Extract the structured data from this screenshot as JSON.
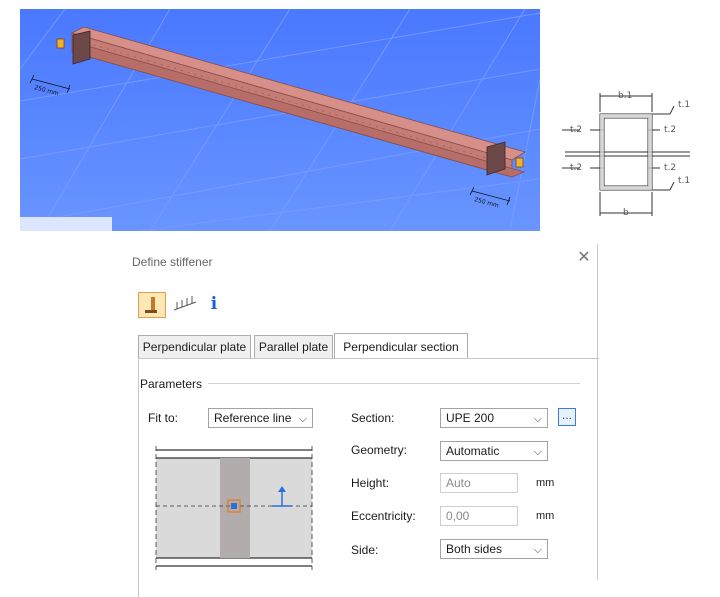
{
  "viewport": {
    "dimension_left": "250 mm",
    "dimension_right": "250 mm"
  },
  "section_sketch": {
    "label_b1": "b.1",
    "label_t1_top": "t.1",
    "label_t2_ul": "t.2",
    "label_t2_ur": "t.2",
    "label_t2_ll": "t.2",
    "label_t2_lr": "t.2",
    "label_t1_bottom": "t.1",
    "label_b": "b"
  },
  "dialog": {
    "title": "Define stiffener",
    "info_glyph": "i",
    "tabs": [
      "Perpendicular plate",
      "Parallel plate",
      "Perpendicular section"
    ],
    "active_tab": "Perpendicular section",
    "group_label": "Parameters",
    "fit_to": {
      "label": "Fit to:",
      "value": "Reference line"
    },
    "section": {
      "label": "Section:",
      "value": "UPE 200",
      "browse_label": "..."
    },
    "geometry": {
      "label": "Geometry:",
      "value": "Automatic"
    },
    "height": {
      "label": "Height:",
      "value": "Auto",
      "unit": "mm"
    },
    "eccentricity": {
      "label": "Eccentricity:",
      "value": "0,00",
      "unit": "mm"
    },
    "side": {
      "label": "Side:",
      "value": "Both sides"
    }
  },
  "colors": {
    "viewport_blue": "#4a78ff",
    "beam": "#c98079",
    "stiffener": "#6d4848",
    "highlight": "#ffe8b5",
    "preview_web": "#b3acac"
  }
}
